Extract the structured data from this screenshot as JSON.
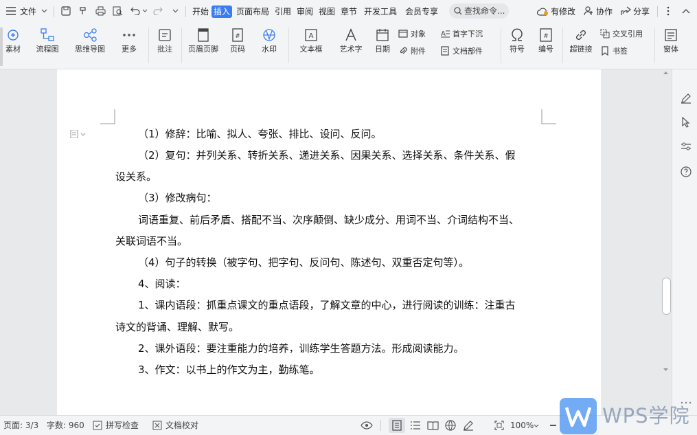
{
  "menubar": {
    "file_label": "文件",
    "menus": [
      "开始",
      "插入",
      "页面布局",
      "引用",
      "审阅",
      "视图",
      "章节",
      "开发工具",
      "会员专享"
    ],
    "active_menu": "插入",
    "search_label": "查找命令...",
    "has_changes_label": "有修改",
    "collab_label": "协作",
    "share_label": "分享"
  },
  "ribbon": {
    "material_label": "素材",
    "flowchart_label": "流程图",
    "mindmap_label": "思维导图",
    "more_label": "更多",
    "comment_label": "批注",
    "header_footer_label": "页眉页脚",
    "page_number_label": "页码",
    "watermark_label": "水印",
    "textbox_label": "文本框",
    "wordart_label": "艺术字",
    "date_label": "日期",
    "object_label": "对象",
    "attachment_label": "附件",
    "dropcap_label": "首字下沉",
    "docpart_label": "文档部件",
    "symbol_label": "符号",
    "numbering_label": "编号",
    "hyperlink_label": "超链接",
    "crossref_label": "交叉引用",
    "bookmark_label": "书签",
    "window_label": "窗体"
  },
  "document": {
    "paragraphs": [
      "（1）修辞：比喻、拟人、夸张、排比、设问、反问。",
      "（2）复句：并列关系、转折关系、递进关系、因果关系、选择关系、条件关系、假",
      "设关系。",
      "（3）修改病句：",
      "词语重复、前后矛盾、搭配不当、次序颠倒、缺少成分、用词不当、介词结构不当、",
      "关联词语不当。",
      "（4）句子的转换（被字句、把字句、反问句、陈述句、双重否定句等）。",
      "4、阅读：",
      "1、课内语段：抓重点课文的重点语段，了解文章的中心，进行阅读的训练：注重古",
      "诗文的背诵、理解、默写。",
      "2、课外语段：要注重能力的培养，训练学生答题方法。形成阅读能力。",
      "3、作文：以书上的作文为主，勤练笔。"
    ]
  },
  "statusbar": {
    "page_label": "页面: 3/3",
    "wordcount_label": "字数: 960",
    "spellcheck_label": "拼写检查",
    "proofread_label": "文档校对",
    "zoom_label": "100%"
  },
  "watermark": {
    "brand": "WPS学院"
  },
  "colors": {
    "accent": "#3b7cf0",
    "ribbon_bg": "#f3f4f6",
    "doc_bg": "#e8e9eb"
  }
}
